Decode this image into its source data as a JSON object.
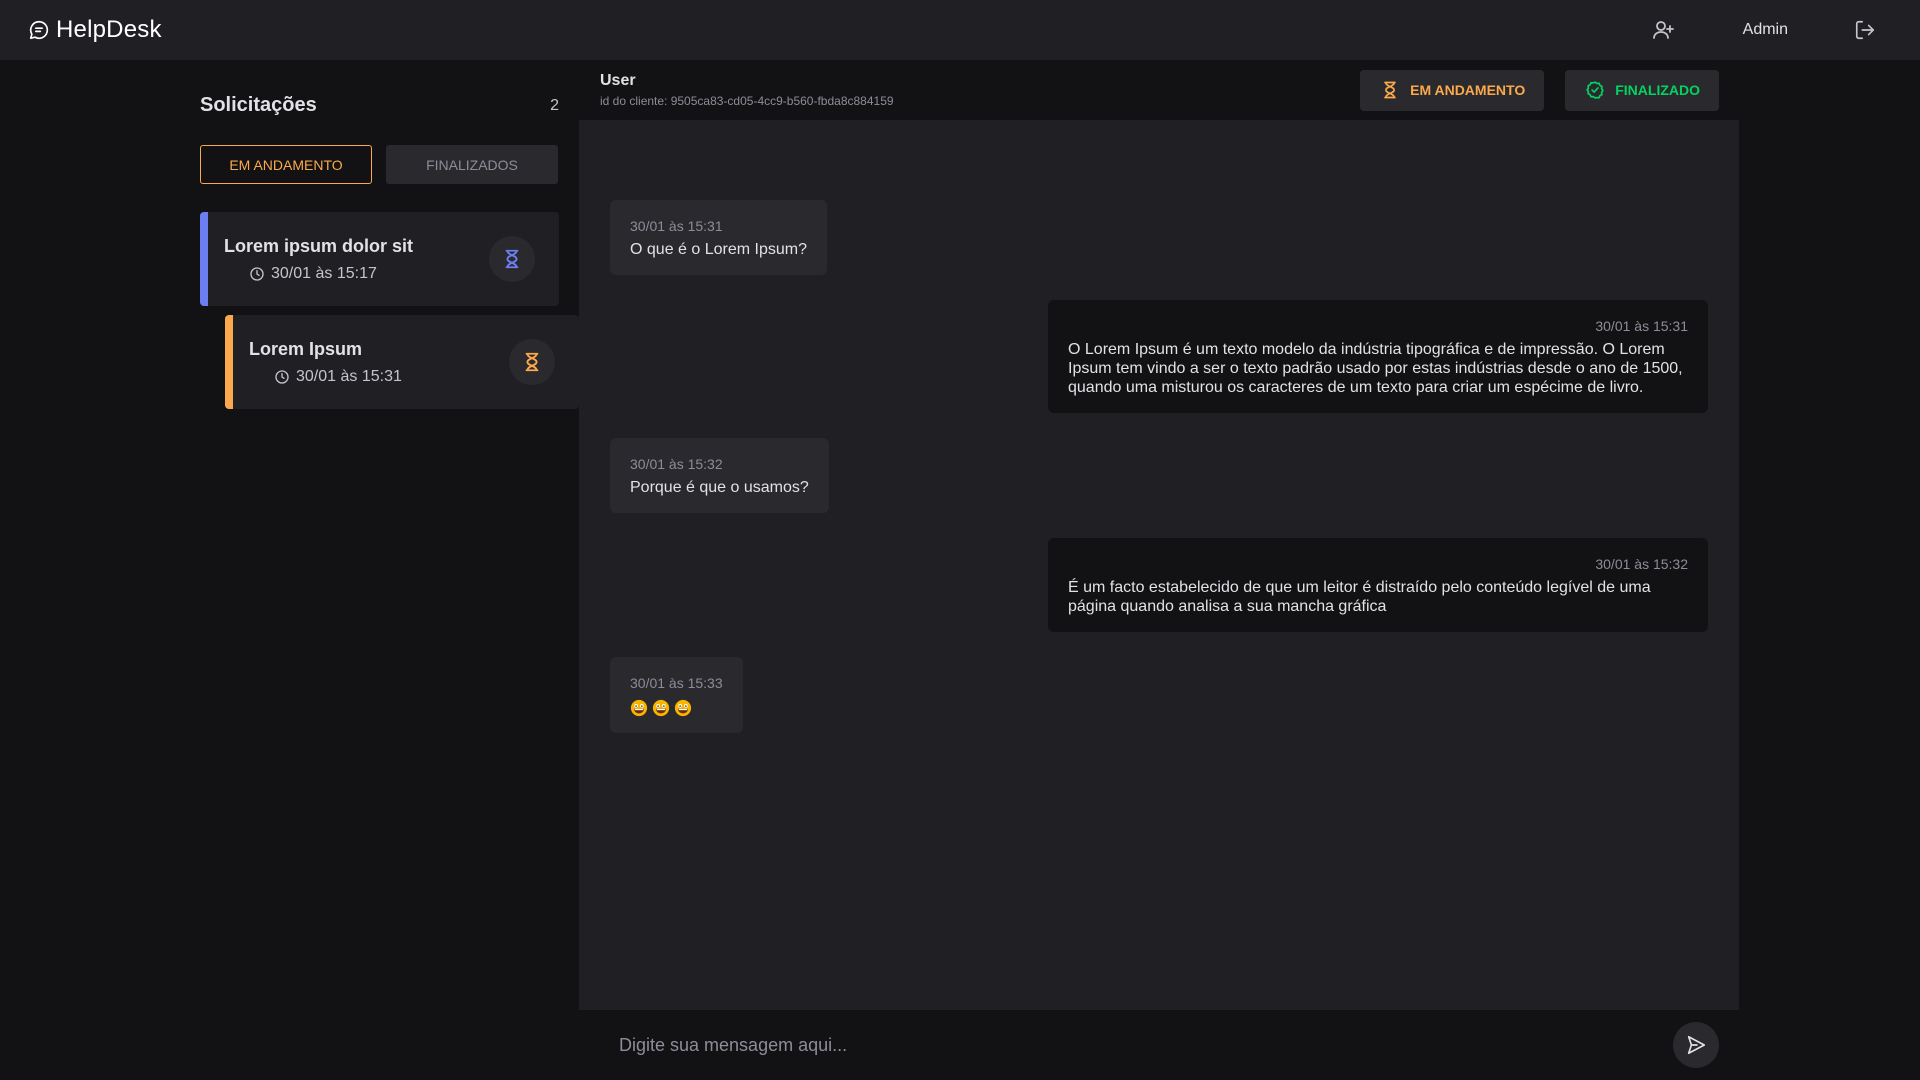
{
  "header": {
    "brand": "HelpDesk",
    "user": "Admin"
  },
  "sidebar": {
    "title": "Solicitações",
    "count": "2",
    "filters": [
      {
        "label": "EM ANDAMENTO",
        "active": true
      },
      {
        "label": "FINALIZADOS",
        "active": false
      }
    ],
    "tickets": [
      {
        "title": "Lorem ipsum dolor sit",
        "time": "30/01 às 15:17",
        "color": "#6c7ff2"
      },
      {
        "title": "Lorem Ipsum",
        "time": "30/01 às 15:31",
        "color": "#fba94c"
      }
    ]
  },
  "chat": {
    "user": "User",
    "client_id": "id do cliente: 9505ca83-cd05-4cc9-b560-fbda8c884159",
    "actions": {
      "in_progress": "EM ANDAMENTO",
      "done": "FINALIZADO"
    },
    "messages": [
      {
        "direction": "in",
        "time": "30/01 às 15:31",
        "text": "O que é o Lorem Ipsum?"
      },
      {
        "direction": "out",
        "time": "30/01 às 15:31",
        "text": "O Lorem Ipsum é um texto modelo da indústria tipográfica e de impressão. O Lorem Ipsum tem vindo a ser o texto padrão usado por estas indústrias desde o ano de 1500, quando uma misturou os caracteres de um texto para criar um espécime de livro."
      },
      {
        "direction": "in",
        "time": "30/01 às 15:32",
        "text": "Porque é que o usamos?"
      },
      {
        "direction": "out",
        "time": "30/01 às 15:32",
        "text": "É um facto estabelecido de que um leitor é distraído pelo conteúdo legível de uma página quando analisa a sua mancha gráfica"
      },
      {
        "direction": "in",
        "time": "30/01 às 15:33",
        "emojis": [
          "grinning-emoji",
          "grinning-emoji",
          "grinning-emoji"
        ]
      }
    ],
    "composer_placeholder": "Digite sua mensagem aqui..."
  },
  "colors": {
    "background": "#121214",
    "panel": "#202024",
    "surface": "#29292e",
    "accent_orange": "#fba94c",
    "accent_green": "#04d361",
    "accent_blue": "#6c7ff2"
  }
}
